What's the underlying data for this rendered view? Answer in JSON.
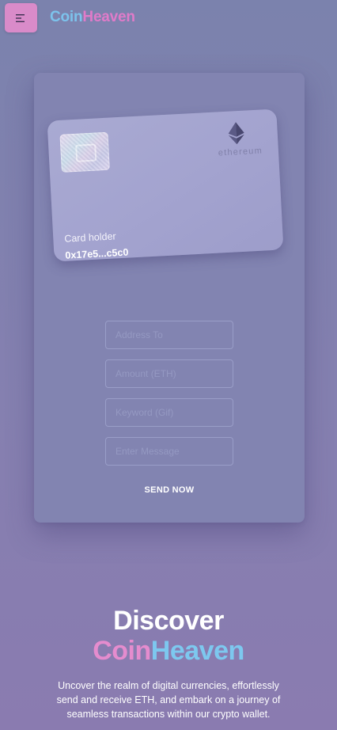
{
  "header": {
    "menu_icon": "menu-icon",
    "logo_part1": "Coin",
    "logo_part2": "Heaven"
  },
  "card": {
    "network_icon": "ethereum-icon",
    "network_name": "ethereum",
    "holder_label": "Card holder",
    "address": "0x17e5...c5c0"
  },
  "form": {
    "address_placeholder": "Address To",
    "amount_placeholder": "Amount (ETH)",
    "keyword_placeholder": "Keyword (Gif)",
    "message_placeholder": "Enter Message",
    "send_label": "SEND NOW"
  },
  "hero": {
    "title_line1": "Discover",
    "title_part1": "Coin",
    "title_part2": "Heaven",
    "description": "Uncover the realm of digital currencies, effortlessly send and receive ETH, and embark on a journey of seamless transactions within our crypto wallet."
  },
  "colors": {
    "background": "#8580b0",
    "menu_button": "#d98bc9",
    "brand_pink": "#e07bc9",
    "brand_blue": "#7cc3ec",
    "card": "#a5a6d0"
  }
}
